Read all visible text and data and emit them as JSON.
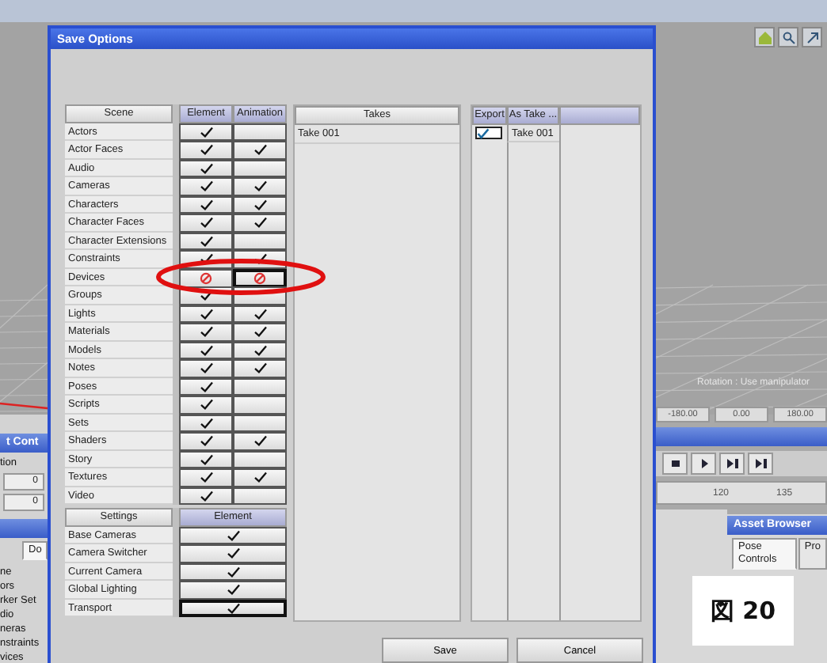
{
  "background": {
    "left_panel": {
      "panel_title": "t Cont",
      "dropdown": "tion",
      "field_1": "0",
      "field_2": "0",
      "tab": "Do",
      "tree_items": [
        "ne",
        "ors",
        "rker Set",
        "dio",
        "neras",
        "nstraints",
        "vices"
      ]
    },
    "viewport": {
      "status": "Rotation : Use manipulator",
      "slider_values": [
        "-180.00",
        "0.00",
        "180.00"
      ]
    },
    "timeline": {
      "ticks": [
        "120",
        "135"
      ]
    },
    "asset_browser": {
      "title": "Asset Browser",
      "tabs": [
        {
          "label": "Pose Controls",
          "selected": true
        },
        {
          "label": "Pro",
          "selected": false
        }
      ]
    }
  },
  "dialog": {
    "title": "Save Options",
    "scene": {
      "header": "Scene",
      "element_header": "Element",
      "animation_header": "Animation",
      "rows": [
        {
          "label": "Actors",
          "element": {
            "checked": true,
            "disabled": false,
            "focused": false
          },
          "animation": {
            "checked": false,
            "disabled": false,
            "focused": false
          }
        },
        {
          "label": "Actor Faces",
          "element": {
            "checked": true,
            "disabled": false,
            "focused": false
          },
          "animation": {
            "checked": true,
            "disabled": false,
            "focused": false
          }
        },
        {
          "label": "Audio",
          "element": {
            "checked": true,
            "disabled": false,
            "focused": false
          },
          "animation": {
            "checked": false,
            "disabled": false,
            "focused": false
          }
        },
        {
          "label": "Cameras",
          "element": {
            "checked": true,
            "disabled": false,
            "focused": false
          },
          "animation": {
            "checked": true,
            "disabled": false,
            "focused": false
          }
        },
        {
          "label": "Characters",
          "element": {
            "checked": true,
            "disabled": false,
            "focused": false
          },
          "animation": {
            "checked": true,
            "disabled": false,
            "focused": false
          }
        },
        {
          "label": "Character Faces",
          "element": {
            "checked": true,
            "disabled": false,
            "focused": false
          },
          "animation": {
            "checked": true,
            "disabled": false,
            "focused": false
          }
        },
        {
          "label": "Character Extensions",
          "element": {
            "checked": true,
            "disabled": false,
            "focused": false
          },
          "animation": {
            "checked": false,
            "disabled": false,
            "focused": false
          }
        },
        {
          "label": "Constraints",
          "element": {
            "checked": true,
            "disabled": false,
            "focused": false
          },
          "animation": {
            "checked": true,
            "disabled": false,
            "focused": false
          }
        },
        {
          "label": "Devices",
          "element": {
            "checked": false,
            "disabled": true,
            "focused": false
          },
          "animation": {
            "checked": false,
            "disabled": true,
            "focused": true
          }
        },
        {
          "label": "Groups",
          "element": {
            "checked": true,
            "disabled": false,
            "focused": false
          },
          "animation": {
            "checked": false,
            "disabled": false,
            "focused": false
          }
        },
        {
          "label": "Lights",
          "element": {
            "checked": true,
            "disabled": false,
            "focused": false
          },
          "animation": {
            "checked": true,
            "disabled": false,
            "focused": false
          }
        },
        {
          "label": "Materials",
          "element": {
            "checked": true,
            "disabled": false,
            "focused": false
          },
          "animation": {
            "checked": true,
            "disabled": false,
            "focused": false
          }
        },
        {
          "label": "Models",
          "element": {
            "checked": true,
            "disabled": false,
            "focused": false
          },
          "animation": {
            "checked": true,
            "disabled": false,
            "focused": false
          }
        },
        {
          "label": "Notes",
          "element": {
            "checked": true,
            "disabled": false,
            "focused": false
          },
          "animation": {
            "checked": true,
            "disabled": false,
            "focused": false
          }
        },
        {
          "label": "Poses",
          "element": {
            "checked": true,
            "disabled": false,
            "focused": false
          },
          "animation": {
            "checked": false,
            "disabled": false,
            "focused": false
          }
        },
        {
          "label": "Scripts",
          "element": {
            "checked": true,
            "disabled": false,
            "focused": false
          },
          "animation": {
            "checked": false,
            "disabled": false,
            "focused": false
          }
        },
        {
          "label": "Sets",
          "element": {
            "checked": true,
            "disabled": false,
            "focused": false
          },
          "animation": {
            "checked": false,
            "disabled": false,
            "focused": false
          }
        },
        {
          "label": "Shaders",
          "element": {
            "checked": true,
            "disabled": false,
            "focused": false
          },
          "animation": {
            "checked": true,
            "disabled": false,
            "focused": false
          }
        },
        {
          "label": "Story",
          "element": {
            "checked": true,
            "disabled": false,
            "focused": false
          },
          "animation": {
            "checked": false,
            "disabled": false,
            "focused": false
          }
        },
        {
          "label": "Textures",
          "element": {
            "checked": true,
            "disabled": false,
            "focused": false
          },
          "animation": {
            "checked": true,
            "disabled": false,
            "focused": false
          }
        },
        {
          "label": "Video",
          "element": {
            "checked": true,
            "disabled": false,
            "focused": false
          },
          "animation": {
            "checked": false,
            "disabled": false,
            "focused": false
          }
        }
      ]
    },
    "settings": {
      "header": "Settings",
      "element_header": "Element",
      "rows": [
        {
          "label": "Base Cameras",
          "element": {
            "checked": true,
            "disabled": false,
            "focused": false
          }
        },
        {
          "label": "Camera Switcher",
          "element": {
            "checked": true,
            "disabled": false,
            "focused": false
          }
        },
        {
          "label": "Current Camera",
          "element": {
            "checked": true,
            "disabled": false,
            "focused": false
          }
        },
        {
          "label": "Global Lighting",
          "element": {
            "checked": true,
            "disabled": false,
            "focused": false
          }
        },
        {
          "label": "Transport",
          "element": {
            "checked": true,
            "disabled": false,
            "focused": true
          }
        }
      ]
    },
    "takes": {
      "header": "Takes",
      "items": [
        "Take 001"
      ]
    },
    "export": {
      "columns": [
        "Export",
        "As Take ..."
      ],
      "rows": [
        {
          "export": true,
          "as_take": "Take 001"
        }
      ]
    },
    "buttons": [
      "Save",
      "Cancel"
    ]
  },
  "figure_label": "図 20"
}
